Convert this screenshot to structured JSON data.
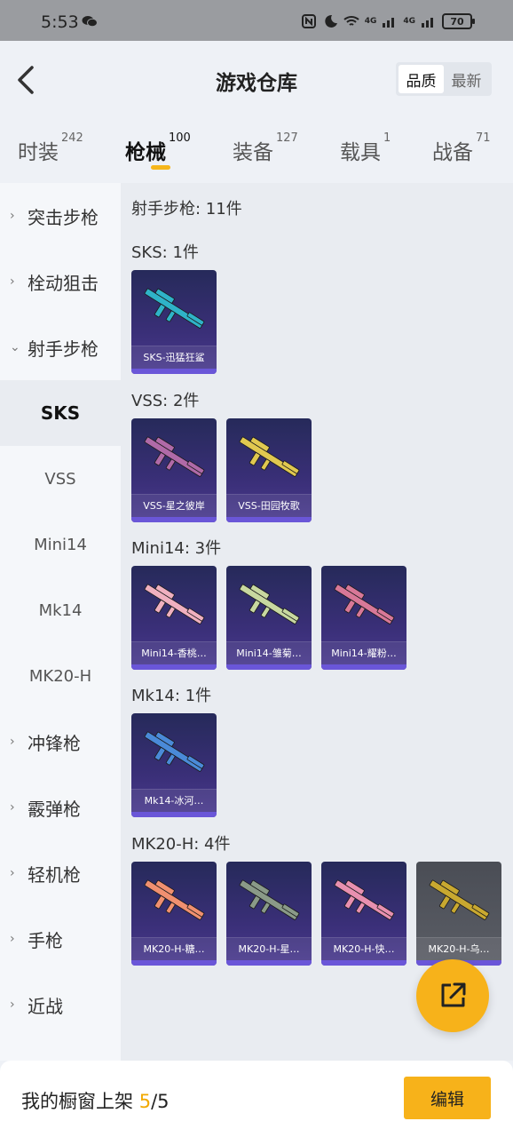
{
  "statusbar": {
    "time": "5:53",
    "battery": "70",
    "net1": "4G",
    "net2": "4G"
  },
  "header": {
    "title": "游戏仓库",
    "sort": [
      "品质",
      "最新"
    ]
  },
  "tabs": [
    {
      "label": "时装",
      "count": "242"
    },
    {
      "label": "枪械",
      "count": "100"
    },
    {
      "label": "装备",
      "count": "127"
    },
    {
      "label": "载具",
      "count": "1"
    },
    {
      "label": "战备",
      "count": "71"
    }
  ],
  "sidebar": [
    {
      "label": "突击步枪",
      "chevron": "›"
    },
    {
      "label": "栓动狙击",
      "chevron": "›"
    },
    {
      "label": "射手步枪",
      "chevron": "⌄"
    },
    {
      "label": "SKS"
    },
    {
      "label": "VSS"
    },
    {
      "label": "Mini14"
    },
    {
      "label": "Mk14"
    },
    {
      "label": "MK20-H"
    },
    {
      "label": "冲锋枪",
      "chevron": "›"
    },
    {
      "label": "霰弹枪",
      "chevron": "›"
    },
    {
      "label": "轻机枪",
      "chevron": "›"
    },
    {
      "label": "手枪",
      "chevron": "›"
    },
    {
      "label": "近战",
      "chevron": "›"
    }
  ],
  "content": {
    "summary": "射手步枪: 11件",
    "groups": [
      {
        "title": "SKS: 1件",
        "items": [
          {
            "name": "SKS-迅猛狂鲨",
            "color": "#2fb3c8"
          }
        ]
      },
      {
        "title": "VSS: 2件",
        "items": [
          {
            "name": "VSS-星之彼岸",
            "color": "#b06aa8"
          },
          {
            "name": "VSS-田园牧歌",
            "color": "#e0c850"
          }
        ]
      },
      {
        "title": "Mini14: 3件",
        "items": [
          {
            "name": "Mini14-香桃…",
            "color": "#f0b0c0"
          },
          {
            "name": "Mini14-雏菊…",
            "color": "#c8d8a0"
          },
          {
            "name": "Mini14-耀粉…",
            "color": "#d87898"
          }
        ]
      },
      {
        "title": "Mk14: 1件",
        "items": [
          {
            "name": "Mk14-冰河…",
            "color": "#4a8ad8"
          }
        ]
      },
      {
        "title": "MK20-H: 4件",
        "items": [
          {
            "name": "MK20-H-糖…",
            "color": "#f09070"
          },
          {
            "name": "MK20-H-星…",
            "color": "#8a9a88"
          },
          {
            "name": "MK20-H-快…",
            "color": "#e890b0"
          },
          {
            "name": "MK20-H-乌…",
            "color": "#c8a830"
          }
        ]
      }
    ]
  },
  "bottom": {
    "label": "我的橱窗上架 ",
    "count": "5",
    "total": "/5",
    "edit": "编辑"
  }
}
